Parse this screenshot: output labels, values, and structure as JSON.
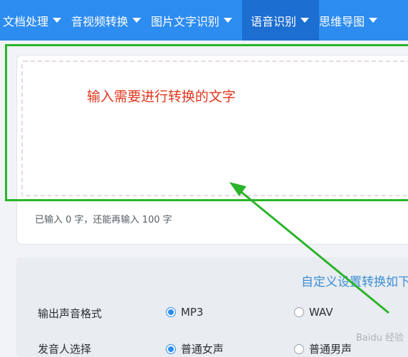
{
  "nav": {
    "items": [
      {
        "label": "文档处理"
      },
      {
        "label": "音视频转换"
      },
      {
        "label": "图片文字识别"
      },
      {
        "label": "语音识别"
      },
      {
        "label": "思维导图"
      }
    ],
    "active_index": 3
  },
  "editor": {
    "hint": "输入需要进行转换的文字",
    "counter": "已输入 0 字，还能再输入 100 字"
  },
  "settings": {
    "custom_link": "自定义设置转换如下",
    "format_label": "输出声音格式",
    "format_options": [
      "MP3",
      "WAV"
    ],
    "format_selected": "MP3",
    "voice_label": "发音人选择",
    "voice_options": [
      "普通女声",
      "普通男声"
    ]
  },
  "watermark": "Baidu 经验",
  "colors": {
    "nav_bg": "#2d8cf0",
    "nav_active": "#1c6ed1",
    "annotation_green": "#2ab42a",
    "hint_red": "#e2371e"
  }
}
